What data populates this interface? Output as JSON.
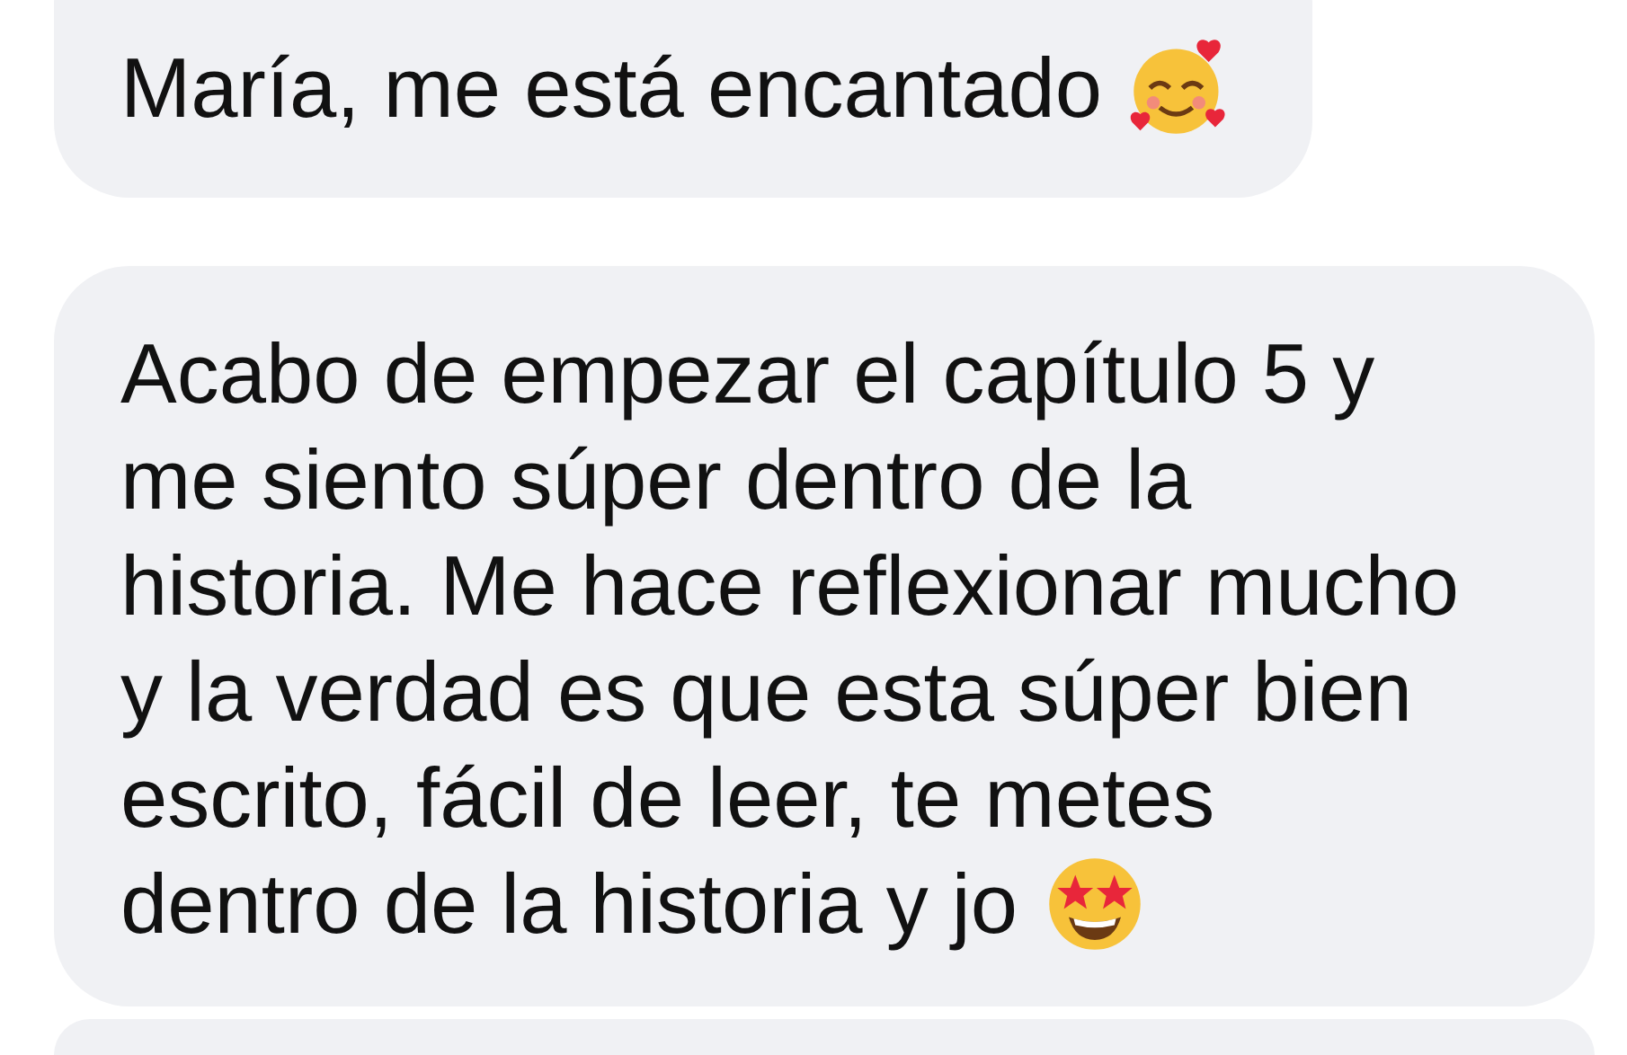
{
  "messages": [
    {
      "kind": "hearts",
      "lines": [
        "María, me está encantado"
      ]
    },
    {
      "kind": "stars",
      "lines": [
        "Acabo de empezar el capítulo 5 y",
        "me siento súper dentro de la",
        "historia. Me hace reflexionar mucho",
        "y la verdad es que esta súper bien",
        "escrito, fácil de leer, te metes",
        "dentro de la historia y jo"
      ]
    }
  ]
}
